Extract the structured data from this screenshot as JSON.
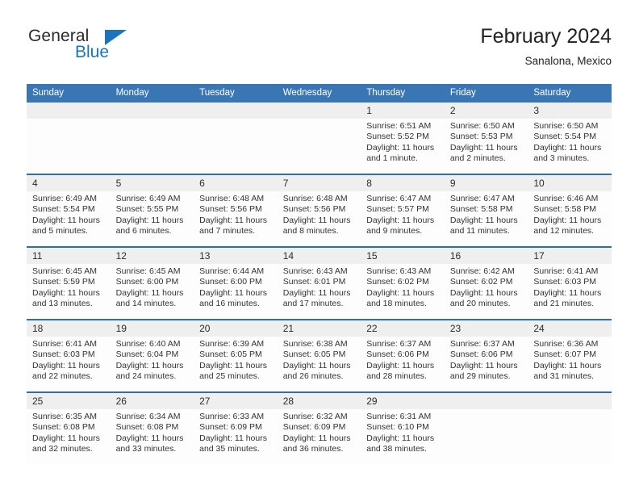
{
  "brand": {
    "line1": "General",
    "line2": "Blue",
    "accent_color": "#1b75bb",
    "triangle_icon": "brand-triangle-icon"
  },
  "header": {
    "title": "February 2024",
    "subtitle": "Sanalona, Mexico"
  },
  "theme": {
    "header_row_bg": "#3b76b4",
    "row_divider": "#2f6fad",
    "daynum_band_bg": "#efefef",
    "text": "#333333"
  },
  "labels": {
    "sunrise_prefix": "Sunrise:",
    "sunset_prefix": "Sunset:",
    "daylight_prefix": "Daylight:"
  },
  "weekday_headers": [
    "Sunday",
    "Monday",
    "Tuesday",
    "Wednesday",
    "Thursday",
    "Friday",
    "Saturday"
  ],
  "weeks": [
    [
      {
        "day": "",
        "sunrise": "",
        "sunset": "",
        "daylight_1": "",
        "daylight_2": "",
        "empty": true
      },
      {
        "day": "",
        "sunrise": "",
        "sunset": "",
        "daylight_1": "",
        "daylight_2": "",
        "empty": true
      },
      {
        "day": "",
        "sunrise": "",
        "sunset": "",
        "daylight_1": "",
        "daylight_2": "",
        "empty": true
      },
      {
        "day": "",
        "sunrise": "",
        "sunset": "",
        "daylight_1": "",
        "daylight_2": "",
        "empty": true
      },
      {
        "day": "1",
        "sunrise": "Sunrise: 6:51 AM",
        "sunset": "Sunset: 5:52 PM",
        "daylight_1": "Daylight: 11 hours",
        "daylight_2": "and 1 minute.",
        "empty": false
      },
      {
        "day": "2",
        "sunrise": "Sunrise: 6:50 AM",
        "sunset": "Sunset: 5:53 PM",
        "daylight_1": "Daylight: 11 hours",
        "daylight_2": "and 2 minutes.",
        "empty": false
      },
      {
        "day": "3",
        "sunrise": "Sunrise: 6:50 AM",
        "sunset": "Sunset: 5:54 PM",
        "daylight_1": "Daylight: 11 hours",
        "daylight_2": "and 3 minutes.",
        "empty": false
      }
    ],
    [
      {
        "day": "4",
        "sunrise": "Sunrise: 6:49 AM",
        "sunset": "Sunset: 5:54 PM",
        "daylight_1": "Daylight: 11 hours",
        "daylight_2": "and 5 minutes.",
        "empty": false
      },
      {
        "day": "5",
        "sunrise": "Sunrise: 6:49 AM",
        "sunset": "Sunset: 5:55 PM",
        "daylight_1": "Daylight: 11 hours",
        "daylight_2": "and 6 minutes.",
        "empty": false
      },
      {
        "day": "6",
        "sunrise": "Sunrise: 6:48 AM",
        "sunset": "Sunset: 5:56 PM",
        "daylight_1": "Daylight: 11 hours",
        "daylight_2": "and 7 minutes.",
        "empty": false
      },
      {
        "day": "7",
        "sunrise": "Sunrise: 6:48 AM",
        "sunset": "Sunset: 5:56 PM",
        "daylight_1": "Daylight: 11 hours",
        "daylight_2": "and 8 minutes.",
        "empty": false
      },
      {
        "day": "8",
        "sunrise": "Sunrise: 6:47 AM",
        "sunset": "Sunset: 5:57 PM",
        "daylight_1": "Daylight: 11 hours",
        "daylight_2": "and 9 minutes.",
        "empty": false
      },
      {
        "day": "9",
        "sunrise": "Sunrise: 6:47 AM",
        "sunset": "Sunset: 5:58 PM",
        "daylight_1": "Daylight: 11 hours",
        "daylight_2": "and 11 minutes.",
        "empty": false
      },
      {
        "day": "10",
        "sunrise": "Sunrise: 6:46 AM",
        "sunset": "Sunset: 5:58 PM",
        "daylight_1": "Daylight: 11 hours",
        "daylight_2": "and 12 minutes.",
        "empty": false
      }
    ],
    [
      {
        "day": "11",
        "sunrise": "Sunrise: 6:45 AM",
        "sunset": "Sunset: 5:59 PM",
        "daylight_1": "Daylight: 11 hours",
        "daylight_2": "and 13 minutes.",
        "empty": false
      },
      {
        "day": "12",
        "sunrise": "Sunrise: 6:45 AM",
        "sunset": "Sunset: 6:00 PM",
        "daylight_1": "Daylight: 11 hours",
        "daylight_2": "and 14 minutes.",
        "empty": false
      },
      {
        "day": "13",
        "sunrise": "Sunrise: 6:44 AM",
        "sunset": "Sunset: 6:00 PM",
        "daylight_1": "Daylight: 11 hours",
        "daylight_2": "and 16 minutes.",
        "empty": false
      },
      {
        "day": "14",
        "sunrise": "Sunrise: 6:43 AM",
        "sunset": "Sunset: 6:01 PM",
        "daylight_1": "Daylight: 11 hours",
        "daylight_2": "and 17 minutes.",
        "empty": false
      },
      {
        "day": "15",
        "sunrise": "Sunrise: 6:43 AM",
        "sunset": "Sunset: 6:02 PM",
        "daylight_1": "Daylight: 11 hours",
        "daylight_2": "and 18 minutes.",
        "empty": false
      },
      {
        "day": "16",
        "sunrise": "Sunrise: 6:42 AM",
        "sunset": "Sunset: 6:02 PM",
        "daylight_1": "Daylight: 11 hours",
        "daylight_2": "and 20 minutes.",
        "empty": false
      },
      {
        "day": "17",
        "sunrise": "Sunrise: 6:41 AM",
        "sunset": "Sunset: 6:03 PM",
        "daylight_1": "Daylight: 11 hours",
        "daylight_2": "and 21 minutes.",
        "empty": false
      }
    ],
    [
      {
        "day": "18",
        "sunrise": "Sunrise: 6:41 AM",
        "sunset": "Sunset: 6:03 PM",
        "daylight_1": "Daylight: 11 hours",
        "daylight_2": "and 22 minutes.",
        "empty": false
      },
      {
        "day": "19",
        "sunrise": "Sunrise: 6:40 AM",
        "sunset": "Sunset: 6:04 PM",
        "daylight_1": "Daylight: 11 hours",
        "daylight_2": "and 24 minutes.",
        "empty": false
      },
      {
        "day": "20",
        "sunrise": "Sunrise: 6:39 AM",
        "sunset": "Sunset: 6:05 PM",
        "daylight_1": "Daylight: 11 hours",
        "daylight_2": "and 25 minutes.",
        "empty": false
      },
      {
        "day": "21",
        "sunrise": "Sunrise: 6:38 AM",
        "sunset": "Sunset: 6:05 PM",
        "daylight_1": "Daylight: 11 hours",
        "daylight_2": "and 26 minutes.",
        "empty": false
      },
      {
        "day": "22",
        "sunrise": "Sunrise: 6:37 AM",
        "sunset": "Sunset: 6:06 PM",
        "daylight_1": "Daylight: 11 hours",
        "daylight_2": "and 28 minutes.",
        "empty": false
      },
      {
        "day": "23",
        "sunrise": "Sunrise: 6:37 AM",
        "sunset": "Sunset: 6:06 PM",
        "daylight_1": "Daylight: 11 hours",
        "daylight_2": "and 29 minutes.",
        "empty": false
      },
      {
        "day": "24",
        "sunrise": "Sunrise: 6:36 AM",
        "sunset": "Sunset: 6:07 PM",
        "daylight_1": "Daylight: 11 hours",
        "daylight_2": "and 31 minutes.",
        "empty": false
      }
    ],
    [
      {
        "day": "25",
        "sunrise": "Sunrise: 6:35 AM",
        "sunset": "Sunset: 6:08 PM",
        "daylight_1": "Daylight: 11 hours",
        "daylight_2": "and 32 minutes.",
        "empty": false
      },
      {
        "day": "26",
        "sunrise": "Sunrise: 6:34 AM",
        "sunset": "Sunset: 6:08 PM",
        "daylight_1": "Daylight: 11 hours",
        "daylight_2": "and 33 minutes.",
        "empty": false
      },
      {
        "day": "27",
        "sunrise": "Sunrise: 6:33 AM",
        "sunset": "Sunset: 6:09 PM",
        "daylight_1": "Daylight: 11 hours",
        "daylight_2": "and 35 minutes.",
        "empty": false
      },
      {
        "day": "28",
        "sunrise": "Sunrise: 6:32 AM",
        "sunset": "Sunset: 6:09 PM",
        "daylight_1": "Daylight: 11 hours",
        "daylight_2": "and 36 minutes.",
        "empty": false
      },
      {
        "day": "29",
        "sunrise": "Sunrise: 6:31 AM",
        "sunset": "Sunset: 6:10 PM",
        "daylight_1": "Daylight: 11 hours",
        "daylight_2": "and 38 minutes.",
        "empty": false
      },
      {
        "day": "",
        "sunrise": "",
        "sunset": "",
        "daylight_1": "",
        "daylight_2": "",
        "empty": true
      },
      {
        "day": "",
        "sunrise": "",
        "sunset": "",
        "daylight_1": "",
        "daylight_2": "",
        "empty": true
      }
    ]
  ]
}
